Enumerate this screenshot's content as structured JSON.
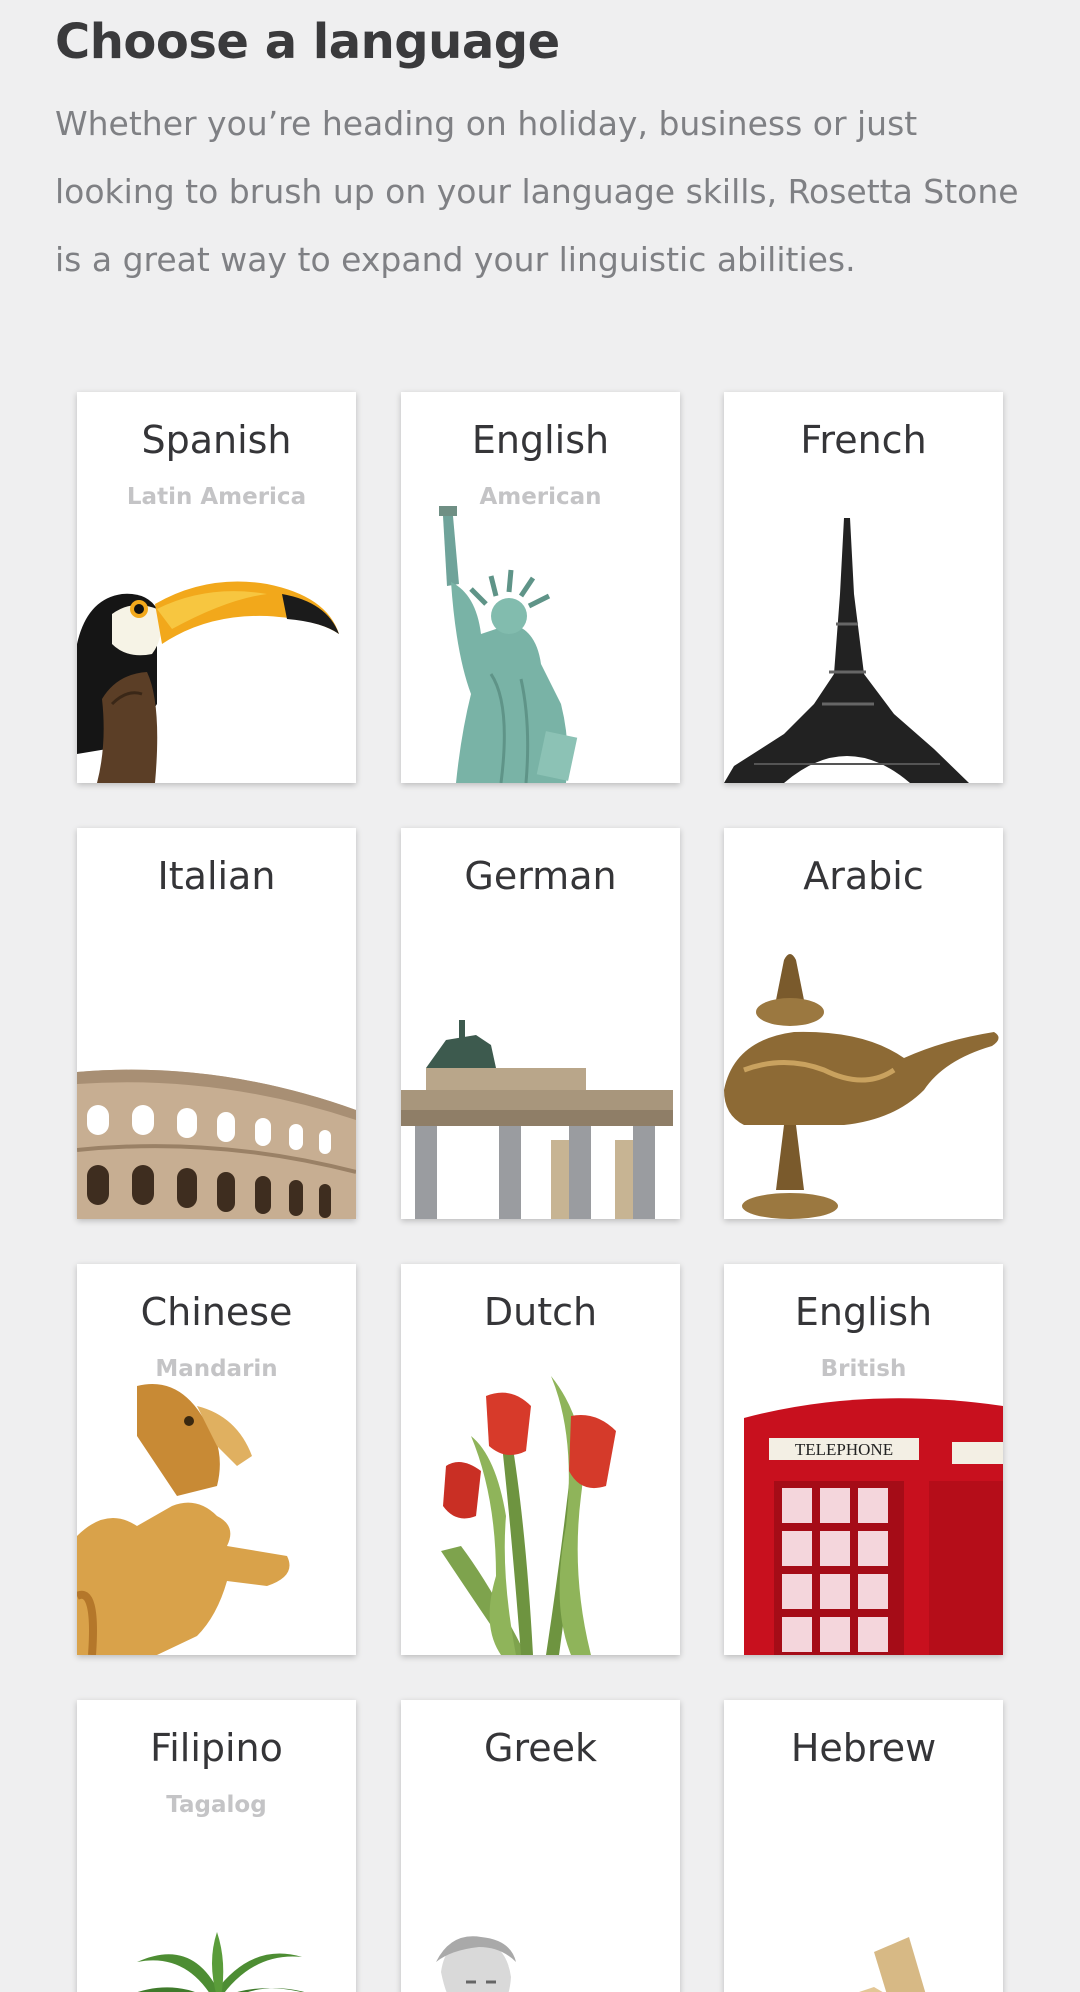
{
  "header": {
    "title": "Choose a language",
    "subtitle": "Whether you’re heading on holiday, business or just looking to brush up on your language skills, Rosetta Stone is a great way to expand your linguistic abilities."
  },
  "languages": [
    {
      "name": "Spanish",
      "variant": "Latin America",
      "image": "toucan-image"
    },
    {
      "name": "English",
      "variant": "American",
      "image": "statue-of-liberty-image"
    },
    {
      "name": "French",
      "variant": "",
      "image": "eiffel-tower-image"
    },
    {
      "name": "Italian",
      "variant": "",
      "image": "colosseum-image"
    },
    {
      "name": "German",
      "variant": "",
      "image": "brandenburg-gate-image"
    },
    {
      "name": "Arabic",
      "variant": "",
      "image": "oil-lamp-image"
    },
    {
      "name": "Chinese",
      "variant": "Mandarin",
      "image": "dragon-image"
    },
    {
      "name": "Dutch",
      "variant": "",
      "image": "tulips-image"
    },
    {
      "name": "English",
      "variant": "British",
      "image": "telephone-box-image"
    },
    {
      "name": "Filipino",
      "variant": "Tagalog",
      "image": "palm-tree-image"
    },
    {
      "name": "Greek",
      "variant": "",
      "image": "greek-statue-image"
    },
    {
      "name": "Hebrew",
      "variant": "",
      "image": "dreidel-image"
    }
  ],
  "image_text": {
    "telephone": "TELEPHONE"
  }
}
